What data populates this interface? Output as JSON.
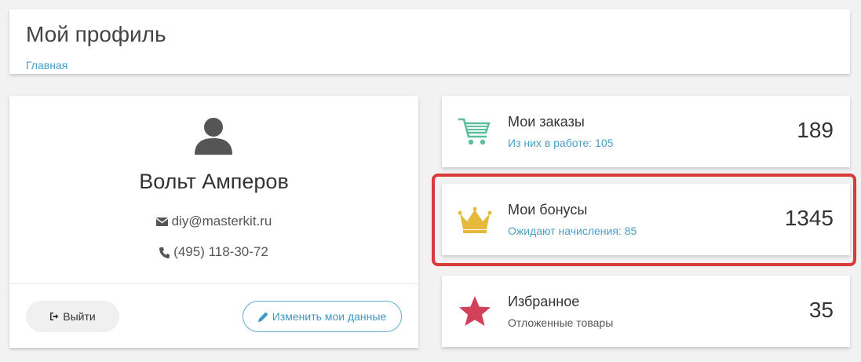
{
  "header": {
    "title": "Мой профиль",
    "breadcrumb": "Главная"
  },
  "profile": {
    "name": "Вольт Амперов",
    "email": "diy@masterkit.ru",
    "phone": "(495) 118-30-72",
    "logout_label": "Выйти",
    "edit_label": "Изменить мои данные"
  },
  "stats": {
    "orders": {
      "label": "Мои заказы",
      "sub": "Из них в работе: 105",
      "value": "189"
    },
    "bonuses": {
      "label": "Мои бонусы",
      "sub": "Ожидают начисления: 85",
      "value": "1345"
    },
    "favorites": {
      "label": "Избранное",
      "sub": "Отложенные товары",
      "value": "35"
    }
  },
  "icons": {
    "cart": "cart-icon",
    "crown": "crown-icon",
    "star": "star-icon",
    "user": "user-icon",
    "envelope": "envelope-icon",
    "phone": "phone-icon",
    "logout": "logout-icon",
    "pencil": "pencil-icon"
  },
  "colors": {
    "link": "#4a9fc7",
    "cart": "#5bbf9a",
    "crown": "#e6b93a",
    "star": "#d2415a",
    "highlight": "#d93a3a"
  }
}
